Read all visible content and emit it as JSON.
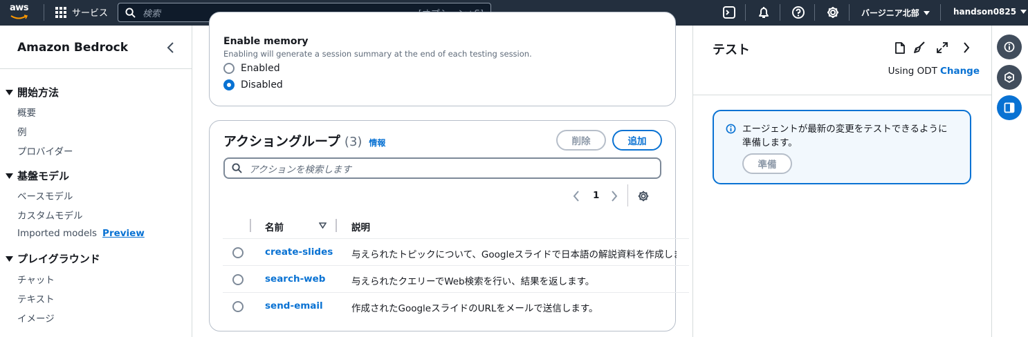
{
  "topbar": {
    "logo_text": "aws",
    "services_label": "サービス",
    "search_placeholder": "検索",
    "search_shortcut": "[オプション+S]",
    "region": "バージニア北部",
    "user": "handson0825"
  },
  "sidebar": {
    "title": "Amazon Bedrock",
    "sections": [
      {
        "title": "開始方法",
        "items": [
          "概要",
          "例",
          "プロバイダー"
        ]
      },
      {
        "title": "基盤モデル",
        "items": [
          "ベースモデル",
          "カスタムモデル",
          "Imported models"
        ]
      },
      {
        "title": "プレイグラウンド",
        "items": [
          "チャット",
          "テキスト",
          "イメージ"
        ]
      }
    ],
    "preview_label": "Preview"
  },
  "memory": {
    "title": "Enable memory",
    "description": "Enabling will generate a session summary at the end of each testing session.",
    "options": [
      "Enabled",
      "Disabled"
    ],
    "selected": "Disabled"
  },
  "action_groups": {
    "title": "アクショングループ",
    "count": "(3)",
    "info_label": "情報",
    "delete_label": "削除",
    "add_label": "追加",
    "search_placeholder": "アクションを検索します",
    "page": "1",
    "columns": [
      "名前",
      "説明"
    ],
    "rows": [
      {
        "name": "create-slides",
        "description": "与えられたトピックについて、Googleスライドで日本語の解説資料を作成します。"
      },
      {
        "name": "search-web",
        "description": "与えられたクエリーでWeb検索を行い、結果を返します。"
      },
      {
        "name": "send-email",
        "description": "作成されたGoogleスライドのURLをメールで送信します。"
      }
    ]
  },
  "test_panel": {
    "title": "テスト",
    "using_label": "Using ODT",
    "change_label": "Change",
    "alert_text": "エージェントが最新の変更をテストできるように準備します。",
    "prepare_label": "準備"
  },
  "colors": {
    "accent": "#0972d3",
    "topbar": "#232f3e"
  }
}
